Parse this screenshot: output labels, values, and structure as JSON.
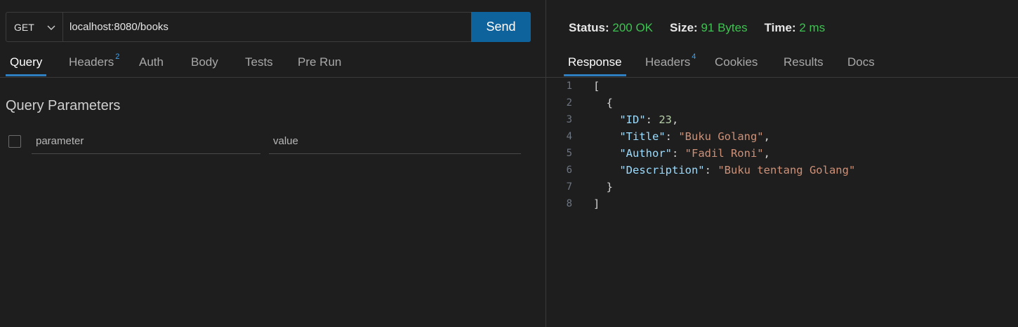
{
  "request": {
    "method": "GET",
    "url": "localhost:8080/books",
    "send_label": "Send"
  },
  "request_tabs": [
    {
      "label": "Query",
      "badge": ""
    },
    {
      "label": "Headers",
      "badge": "2"
    },
    {
      "label": "Auth",
      "badge": ""
    },
    {
      "label": "Body",
      "badge": ""
    },
    {
      "label": "Tests",
      "badge": ""
    },
    {
      "label": "Pre Run",
      "badge": ""
    }
  ],
  "query": {
    "title": "Query Parameters",
    "param_placeholder": "parameter",
    "value_placeholder": "value"
  },
  "status": {
    "status_label": "Status:",
    "status_value": "200 OK",
    "size_label": "Size:",
    "size_value": "91 Bytes",
    "time_label": "Time:",
    "time_value": "2 ms",
    "ok_color": "#3ec251"
  },
  "response_tabs": [
    {
      "label": "Response",
      "badge": ""
    },
    {
      "label": "Headers",
      "badge": "4"
    },
    {
      "label": "Cookies",
      "badge": ""
    },
    {
      "label": "Results",
      "badge": ""
    },
    {
      "label": "Docs",
      "badge": ""
    }
  ],
  "response_body": {
    "line_numbers": [
      "1",
      "2",
      "3",
      "4",
      "5",
      "6",
      "7",
      "8"
    ],
    "open_bracket": "[",
    "open_brace": "{",
    "fields": [
      {
        "key": "\"ID\"",
        "value": "23",
        "type": "number",
        "comma": ","
      },
      {
        "key": "\"Title\"",
        "value": "\"Buku Golang\"",
        "type": "string",
        "comma": ","
      },
      {
        "key": "\"Author\"",
        "value": "\"Fadil Roni\"",
        "type": "string",
        "comma": ","
      },
      {
        "key": "\"Description\"",
        "value": "\"Buku tentang Golang\"",
        "type": "string",
        "comma": ""
      }
    ],
    "close_brace": "}",
    "close_bracket": "]"
  },
  "colors": {
    "accent": "#0e639c",
    "tab_underline": "#2e7fc2",
    "badge": "#3ba3f2"
  }
}
